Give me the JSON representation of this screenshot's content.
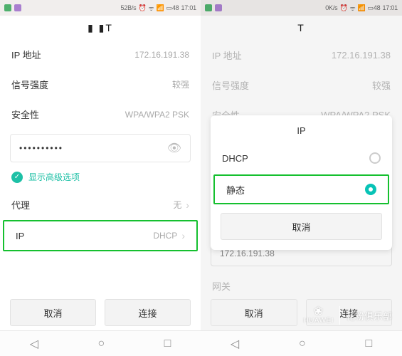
{
  "left": {
    "status": {
      "speed": "52B/s",
      "time": "17:01",
      "battery": "48"
    },
    "title": "▮ ▮T",
    "rows": {
      "ip_label": "IP 地址",
      "ip_value": "172.16.191.38",
      "signal_label": "信号强度",
      "signal_value": "较强",
      "security_label": "安全性",
      "security_value": "WPA/WPA2 PSK"
    },
    "password_value": "••••••••••",
    "advanced_label": "显示高级选项",
    "proxy_label": "代理",
    "proxy_value": "无",
    "ip_setting_label": "IP",
    "ip_setting_value": "DHCP",
    "buttons": {
      "cancel": "取消",
      "connect": "连接"
    }
  },
  "right": {
    "status": {
      "speed": "0K/s",
      "time": "17:01",
      "battery": "48"
    },
    "title": "T",
    "rows": {
      "ip_label": "IP 地址",
      "ip_value": "172.16.191.38",
      "signal_label": "信号强度",
      "signal_value": "较强",
      "security_label": "安全性",
      "security_value": "WPA/WPA2 PSK"
    },
    "under_field": "172.16.191.38",
    "gateway_label": "网关",
    "modal": {
      "title": "IP",
      "opt_dhcp": "DHCP",
      "opt_static": "静态",
      "cancel": "取消"
    },
    "buttons": {
      "cancel": "取消",
      "connect": "连接"
    }
  },
  "watermark": {
    "brand": "HUAWEI",
    "text": "花粉俱乐部"
  }
}
